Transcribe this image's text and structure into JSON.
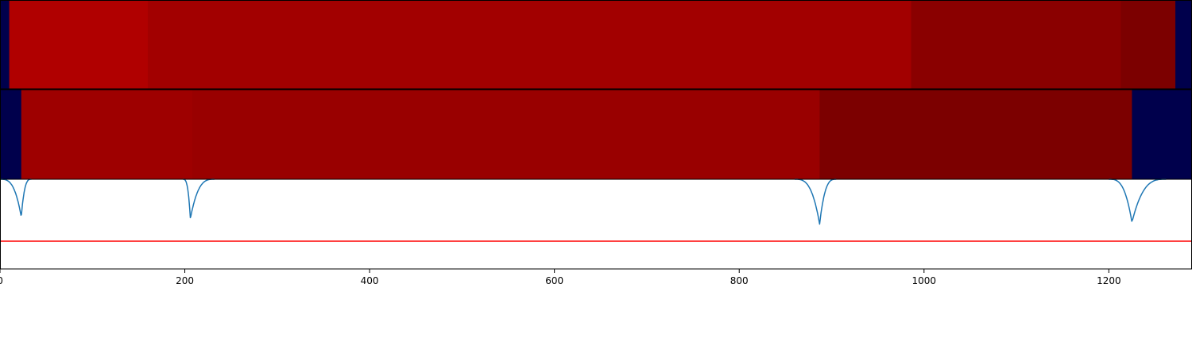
{
  "chart_data": {
    "type": "heatmap",
    "x_range": [
      0,
      1290
    ],
    "x_ticks": [
      0,
      200,
      400,
      600,
      800,
      1000,
      1200
    ],
    "x_tick_labels": [
      "0",
      "200",
      "400",
      "600",
      "800",
      "1000",
      "1200"
    ],
    "grid": false,
    "segments_top": [
      {
        "x0": 0,
        "x1": 10,
        "color": "#00004c"
      },
      {
        "x0": 10,
        "x1": 160,
        "color": "#b00000"
      },
      {
        "x0": 160,
        "x1": 986,
        "color": "#a20000"
      },
      {
        "x0": 986,
        "x1": 1213,
        "color": "#8a0000"
      },
      {
        "x0": 1213,
        "x1": 1272,
        "color": "#7c0000"
      },
      {
        "x0": 1272,
        "x1": 1290,
        "color": "#00004c"
      }
    ],
    "segments_bottom": [
      {
        "x0": 0,
        "x1": 23,
        "color": "#00004c"
      },
      {
        "x0": 23,
        "x1": 208,
        "color": "#9e0000"
      },
      {
        "x0": 208,
        "x1": 887,
        "color": "#990000"
      },
      {
        "x0": 887,
        "x1": 1225,
        "color": "#7c0000"
      },
      {
        "x0": 1225,
        "x1": 1290,
        "color": "#00004c"
      }
    ],
    "line_series": {
      "color": "#1f77b4",
      "y_range": [
        0,
        1
      ],
      "baseline": 1.0,
      "dips": [
        {
          "x_start": 0,
          "x_min": 23,
          "x_end": 34,
          "y_min": 0.58
        },
        {
          "x_start": 198,
          "x_min": 206,
          "x_end": 232,
          "y_min": 0.56
        },
        {
          "x_start": 860,
          "x_min": 887,
          "x_end": 905,
          "y_min": 0.5
        },
        {
          "x_start": 1200,
          "x_min": 1225,
          "x_end": 1262,
          "y_min": 0.52
        }
      ]
    },
    "threshold": {
      "y": 0.31,
      "color": "#ff0000"
    }
  }
}
